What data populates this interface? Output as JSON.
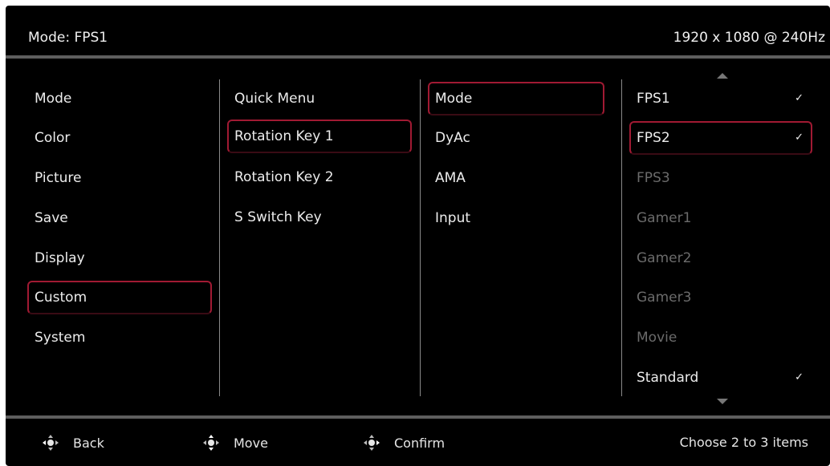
{
  "header": {
    "mode": "Mode: FPS1",
    "resolution": "1920 x 1080 @ 240Hz"
  },
  "menu1": {
    "items": [
      "Mode",
      "Color",
      "Picture",
      "Save",
      "Display",
      "Custom",
      "System"
    ],
    "selected": "Custom"
  },
  "menu2": {
    "items": [
      "Quick Menu",
      "Rotation Key 1",
      "Rotation Key 2",
      "S Switch Key"
    ],
    "selected": "Rotation Key 1"
  },
  "menu3": {
    "items": [
      "Mode",
      "DyAc",
      "AMA",
      "Input"
    ],
    "selected": "Mode"
  },
  "menu4": {
    "items": [
      "FPS1",
      "FPS2",
      "FPS3",
      "Gamer1",
      "Gamer2",
      "Gamer3",
      "Movie",
      "Standard"
    ],
    "checked": [
      "FPS1",
      "FPS2",
      "Standard"
    ],
    "selected": "FPS2",
    "disabled": [
      "FPS3",
      "Gamer1",
      "Gamer2",
      "Gamer3",
      "Movie"
    ]
  },
  "footer": {
    "back": "Back",
    "move": "Move",
    "confirm": "Confirm",
    "hint": "Choose 2 to 3 items"
  },
  "colors": {
    "accent": "#a11a33",
    "background": "#000000",
    "disabled_text": "#6b6b6b"
  },
  "icons": {
    "check": "check-icon",
    "joystick": "joystick-icon",
    "scroll_up": "scroll-up-arrow-icon",
    "scroll_down": "scroll-down-arrow-icon"
  }
}
